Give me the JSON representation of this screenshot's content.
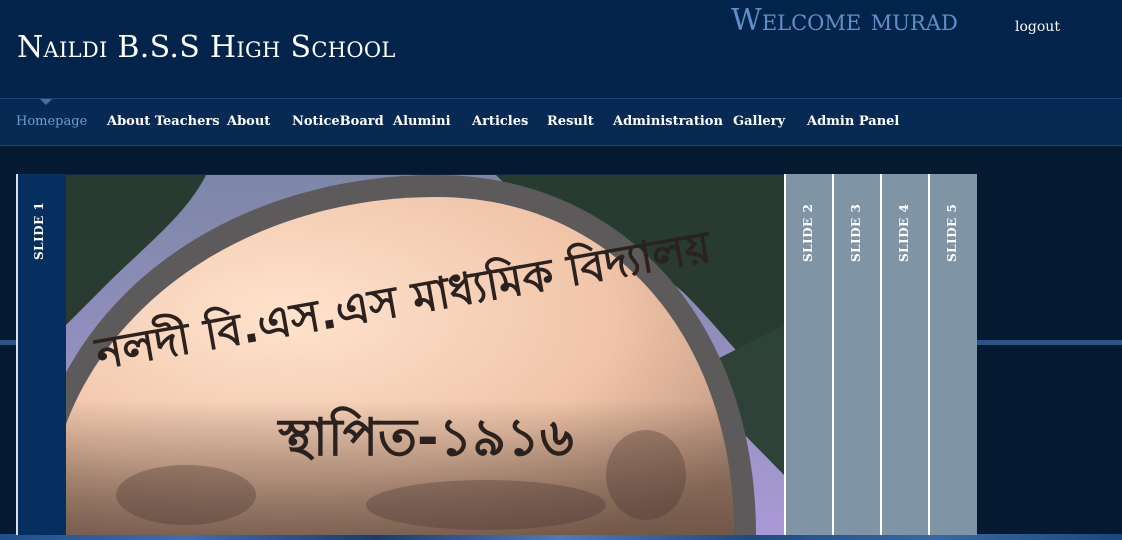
{
  "header": {
    "site_title": "Naildi B.S.S High School",
    "welcome": "Welcome murad",
    "logout": "logout"
  },
  "nav": {
    "items": [
      {
        "label": "Homepage",
        "active": true
      },
      {
        "label": "About Teachers"
      },
      {
        "label": "About"
      },
      {
        "label": "NoticeBoard"
      },
      {
        "label": "Alumini"
      },
      {
        "label": "Articles"
      },
      {
        "label": "Result"
      },
      {
        "label": "Administration"
      },
      {
        "label": "Gallery"
      },
      {
        "label": "Admin Panel"
      }
    ]
  },
  "slider": {
    "tabs": [
      "SLIDE 1",
      "SLIDE 2",
      "SLIDE 3",
      "SLIDE 4",
      "SLIDE 5"
    ],
    "active_tab": "SLIDE 1",
    "photo_inscription_line1": "নলদী বি.এস.এস মাধ্যমিক বিদ্যালয়",
    "photo_inscription_line2": "স্থাপিত-১৯১৬"
  },
  "colors": {
    "header_bg": "#03244a",
    "nav_bg": "#072a55",
    "page_bg": "#051931",
    "accent_welcome": "#5f8fc8",
    "active_tab": "#062f5f",
    "inactive_tab": "#7f95a6"
  }
}
